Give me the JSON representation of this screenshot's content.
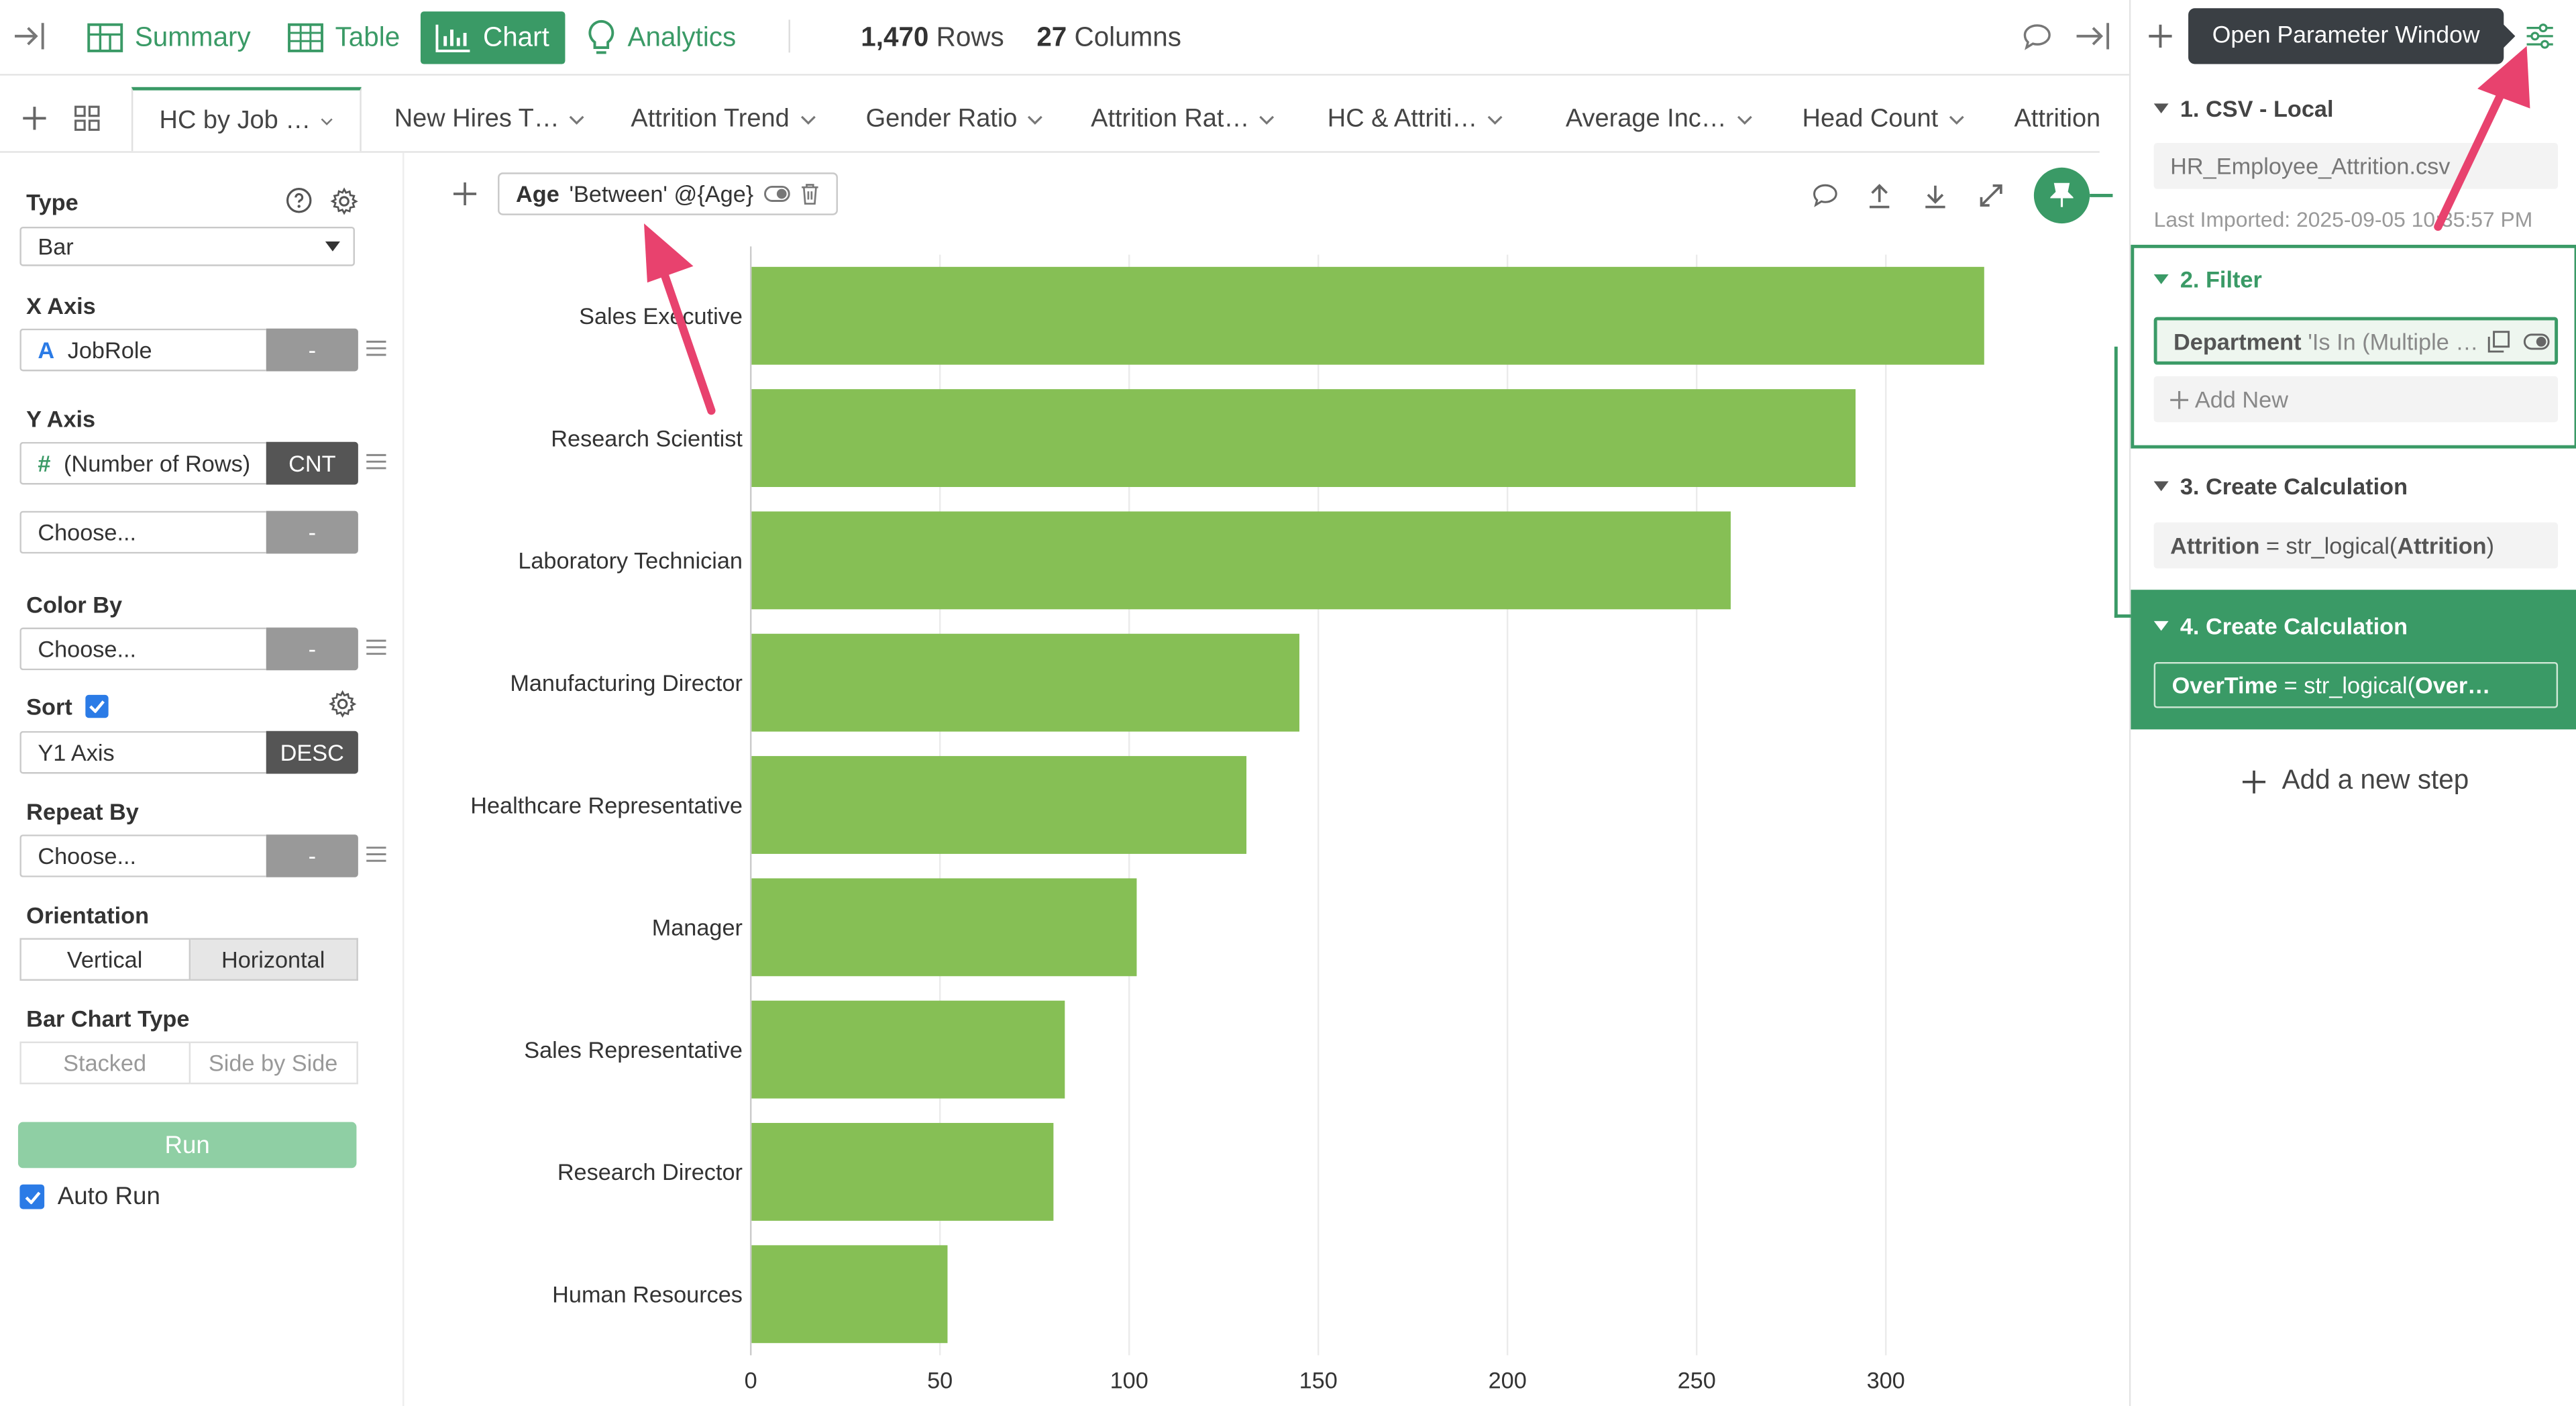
{
  "topbar": {
    "views": [
      {
        "label": "Summary",
        "icon": "summary-icon"
      },
      {
        "label": "Table",
        "icon": "table-icon"
      },
      {
        "label": "Chart",
        "icon": "chart-icon"
      },
      {
        "label": "Analytics",
        "icon": "analytics-icon"
      }
    ],
    "rows_count": "1,470",
    "rows_label": "Rows",
    "cols_count": "27",
    "cols_label": "Columns"
  },
  "tabs": [
    "HC by Job …",
    "New Hires T…",
    "Attrition Trend",
    "Gender Ratio",
    "Attrition Rat…",
    "HC & Attriti…",
    "Average Inc…",
    "Head Count",
    "Attrition"
  ],
  "config": {
    "type_label": "Type",
    "type_value": "Bar",
    "x_axis_label": "X Axis",
    "x_axis_value": "JobRole",
    "x_axis_type_glyph": "A",
    "x_axis_agg": "-",
    "y_axis_label": "Y Axis",
    "y_axis_value": "(Number of Rows)",
    "y_axis_type_glyph": "#",
    "y_axis_agg": "CNT",
    "y2_placeholder": "Choose...",
    "y2_agg": "-",
    "color_by_label": "Color By",
    "color_by_value": "Choose...",
    "color_by_agg": "-",
    "sort_label": "Sort",
    "sort_value": "Y1 Axis",
    "sort_order": "DESC",
    "repeat_by_label": "Repeat By",
    "repeat_by_value": "Choose...",
    "repeat_by_agg": "-",
    "orientation_label": "Orientation",
    "orientation_options": [
      "Vertical",
      "Horizontal"
    ],
    "bar_type_label": "Bar Chart Type",
    "bar_type_options": [
      "Stacked",
      "Side by Side"
    ],
    "run_label": "Run",
    "auto_run_label": "Auto Run"
  },
  "filter_pill": {
    "field": "Age",
    "condition": "'Between' @{Age}"
  },
  "chart_data": {
    "type": "bar",
    "orientation": "horizontal",
    "categories": [
      "Sales Executive",
      "Research Scientist",
      "Laboratory Technician",
      "Manufacturing Director",
      "Healthcare Representative",
      "Manager",
      "Sales Representative",
      "Research Director",
      "Human Resources"
    ],
    "values": [
      326,
      292,
      259,
      145,
      131,
      102,
      83,
      80,
      52
    ],
    "xlim": [
      0,
      340
    ],
    "xticks": [
      0,
      50,
      100,
      150,
      200,
      250,
      300
    ],
    "bar_color": "#86bf55",
    "grid": true
  },
  "right_panel": {
    "tooltip": "Open Parameter Window",
    "steps": [
      {
        "number": "1.",
        "title": "CSV - Local",
        "detail": "HR_Employee_Attrition.csv",
        "meta": "Last Imported: 2025-09-05 10:35:57 PM"
      },
      {
        "number": "2.",
        "title": "Filter",
        "detail_field": "Department",
        "detail_rest": "'Is In (Multiple …",
        "add_new": "Add New"
      },
      {
        "number": "3.",
        "title": "Create Calculation",
        "detail_field": "Attrition",
        "detail_rest": " = str_logical(",
        "detail_arg": "Attrition",
        "detail_end": ")"
      },
      {
        "number": "4.",
        "title": "Create Calculation",
        "detail_field": "OverTime",
        "detail_rest": " = str_logical(",
        "detail_arg": "Over…"
      }
    ],
    "add_step_label": "Add a new step"
  },
  "colors": {
    "accent": "#3a9a66",
    "bar": "#86bf55",
    "annotation_arrow": "#e8426e"
  }
}
